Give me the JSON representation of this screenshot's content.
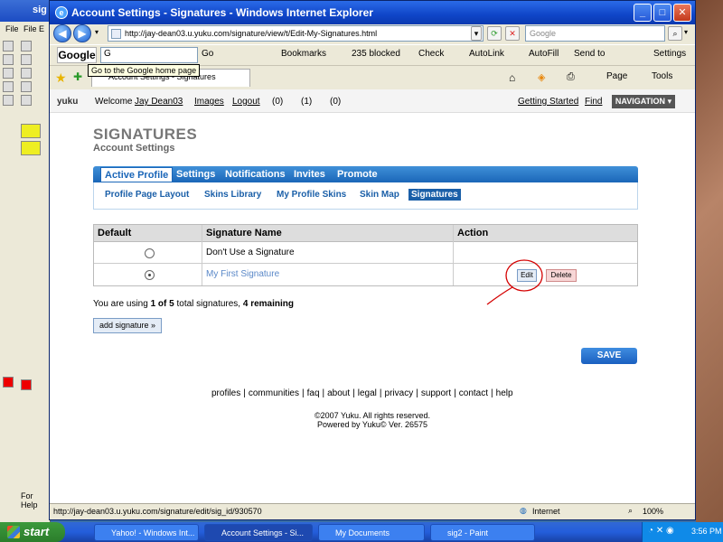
{
  "paint_windows": [
    {
      "title": "",
      "menu": "File",
      "help": ""
    },
    {
      "title": "sig",
      "menu": "File  E",
      "help": "For Help"
    }
  ],
  "ie": {
    "title": "Account Settings - Signatures - Windows Internet Explorer",
    "url": "http://jay-dean03.u.yuku.com/signature/view/t/Edit-My-Signatures.html",
    "search_placeholder": "Google",
    "google_label": "Google",
    "google_input": "G",
    "go": "Go",
    "bookmarks": "Bookmarks",
    "blocked": "235 blocked",
    "check": "Check",
    "autolink": "AutoLink",
    "autofill": "AutoFill",
    "sendto": "Send to",
    "settings": "Settings",
    "tooltip": "Go to the Google home page",
    "tab": "Account Settings - Signatures",
    "page": "Page",
    "tools": "Tools",
    "status_url": "http://jay-dean03.u.yuku.com/signature/edit/sig_id/930570",
    "zone": "Internet",
    "zoom": "100%"
  },
  "yuku": {
    "logo": "yuku",
    "welcome": "Welcome",
    "user": "Jay Dean03",
    "images": "Images",
    "logout": "Logout",
    "c1": "(0)",
    "c2": "(1)",
    "c3": "(0)",
    "getting_started": "Getting Started",
    "find": "Find",
    "navigation": "NAVIGATION"
  },
  "heading": "SIGNATURES",
  "subheading": "Account Settings",
  "topnav": [
    "Active Profile",
    "Settings",
    "Notifications",
    "Invites",
    "Promote"
  ],
  "subnav": [
    "Profile Page Layout",
    "Skins Library",
    "My Profile Skins",
    "Skin Map",
    "Signatures"
  ],
  "table": {
    "headers": [
      "Default",
      "Signature Name",
      "Action"
    ],
    "rows": [
      {
        "name": "Don't Use a Signature",
        "selected": false
      },
      {
        "name": "My First Signature",
        "selected": true
      }
    ],
    "edit": "Edit",
    "delete": "Delete"
  },
  "usage": {
    "pre": "You are using ",
    "count": "1 of 5",
    "mid": " total signatures, ",
    "rem": "4 remaining"
  },
  "add_signature": "add signature »",
  "save": "SAVE",
  "footer": [
    "profiles",
    "communities",
    "faq",
    "about",
    "legal",
    "privacy",
    "support",
    "contact",
    "help"
  ],
  "copyright": "©2007 Yuku. All rights reserved.",
  "powered": "Powered by Yuku© Ver. 26575",
  "taskbar": {
    "start": "start",
    "tasks": [
      "Yahoo! - Windows Int...",
      "Account Settings - Si...",
      "My Documents",
      "sig2 - Paint"
    ],
    "clock": "3:56 PM"
  },
  "colors": {
    "accent": "#1a66b8",
    "annotation": "#d40000"
  }
}
